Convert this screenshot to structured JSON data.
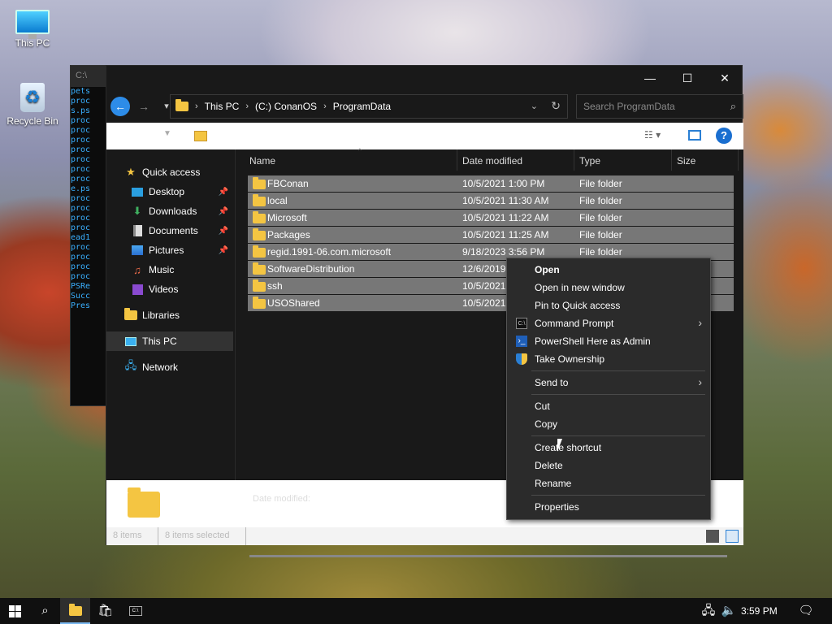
{
  "desktop": {
    "icons": [
      {
        "label": "This PC"
      },
      {
        "label": "Recycle Bin"
      }
    ]
  },
  "cmd_back": {
    "title": "C:\\",
    "lines": [
      "pets",
      "proc",
      "s.ps",
      "proc",
      "proc",
      "proc",
      "proc",
      "",
      "proc",
      "",
      "proc",
      "proc",
      "e.ps",
      "proc",
      "proc",
      "proc",
      "proc",
      "ead1",
      "proc",
      "",
      "proc",
      "proc",
      "proc",
      "PSRe",
      "Succ",
      "Pres",
      "",
      ""
    ]
  },
  "explorer": {
    "window_controls": {
      "minimize": "—",
      "maximize": "☐",
      "close": "✕"
    },
    "breadcrumb": [
      "This PC",
      "(C:) ConanOS",
      "ProgramData"
    ],
    "search_placeholder": "Search ProgramData",
    "nav": [
      {
        "label": "Quick access",
        "icon": "star-icon",
        "pinned": false
      },
      {
        "label": "Desktop",
        "icon": "desktop-icon",
        "pinned": true
      },
      {
        "label": "Downloads",
        "icon": "download-icon",
        "pinned": true
      },
      {
        "label": "Documents",
        "icon": "documents-icon",
        "pinned": true
      },
      {
        "label": "Pictures",
        "icon": "pictures-icon",
        "pinned": true
      },
      {
        "label": "Music",
        "icon": "music-icon",
        "pinned": false
      },
      {
        "label": "Videos",
        "icon": "videos-icon",
        "pinned": false
      },
      {
        "label": "Libraries",
        "icon": "libraries-icon",
        "pinned": false
      },
      {
        "label": "This PC",
        "icon": "this-pc-icon",
        "pinned": false
      },
      {
        "label": "Network",
        "icon": "network-icon",
        "pinned": false
      }
    ],
    "columns": {
      "name": "Name",
      "date": "Date modified",
      "type": "Type",
      "size": "Size"
    },
    "files": [
      {
        "name": "FBConan",
        "date": "10/5/2021 1:00 PM",
        "type": "File folder"
      },
      {
        "name": "local",
        "date": "10/5/2021 11:30 AM",
        "type": "File folder"
      },
      {
        "name": "Microsoft",
        "date": "10/5/2021 11:22 AM",
        "type": "File folder"
      },
      {
        "name": "Packages",
        "date": "10/5/2021 11:25 AM",
        "type": "File folder"
      },
      {
        "name": "regid.1991-06.com.microsoft",
        "date": "9/18/2023 3:56 PM",
        "type": "File folder"
      },
      {
        "name": "SoftwareDistribution",
        "date": "12/6/2019",
        "type": ""
      },
      {
        "name": "ssh",
        "date": "10/5/2021",
        "type": ""
      },
      {
        "name": "USOShared",
        "date": "10/5/2021",
        "type": ""
      }
    ],
    "details": {
      "date_modified_label": "Date modified:"
    },
    "status": {
      "items": "8 items",
      "selected": "8 items selected"
    }
  },
  "context_menu": {
    "items": [
      {
        "label": "Open",
        "bold": true
      },
      {
        "label": "Open in new window"
      },
      {
        "label": "Pin to Quick access"
      },
      {
        "label": "Command Prompt",
        "icon": "cmd-icon",
        "submenu": true
      },
      {
        "label": "PowerShell Here as Admin",
        "icon": "powershell-icon"
      },
      {
        "label": "Take Ownership",
        "icon": "shield-icon"
      },
      {
        "label": "Send to",
        "submenu": true
      },
      {
        "label": "Cut"
      },
      {
        "label": "Copy"
      },
      {
        "label": "Create shortcut"
      },
      {
        "label": "Delete"
      },
      {
        "label": "Rename"
      },
      {
        "label": "Properties"
      }
    ]
  },
  "taskbar": {
    "clock": "3:59 PM"
  },
  "colors": {
    "accent": "#2d8ce8",
    "folder": "#f4c542",
    "selection": "#777777",
    "menu_bg": "#2b2b2b"
  }
}
